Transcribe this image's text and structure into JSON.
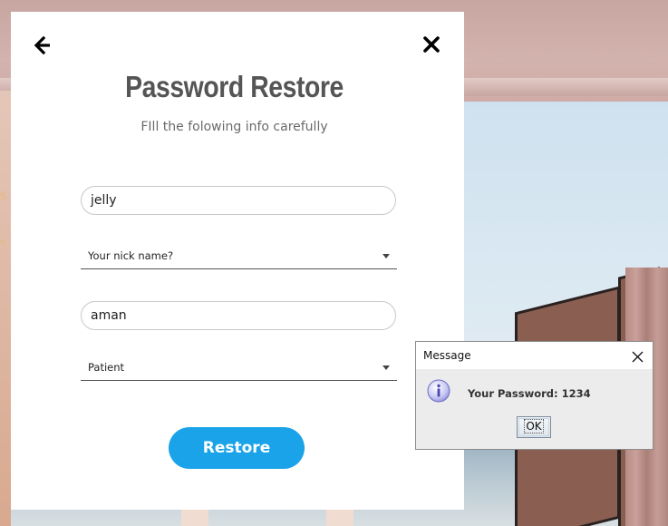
{
  "window": {
    "title": "Password Restore",
    "subtitle": "FIll the folowing info carefully",
    "username_value": "jelly",
    "security_question": "Your nick name?",
    "answer_value": "aman",
    "role": "Patient",
    "restore_label": "Restore",
    "icons": [
      "back-arrow-icon",
      "close-icon",
      "chevron-down-icon"
    ]
  },
  "dialog": {
    "title": "Message",
    "message": "Your Password: 1234",
    "ok_label": "OK",
    "icons": [
      "info-icon",
      "close-icon"
    ]
  },
  "colors": {
    "accent": "#1aa3e8",
    "title_text": "#555555",
    "dialog_bg": "#ececec"
  }
}
